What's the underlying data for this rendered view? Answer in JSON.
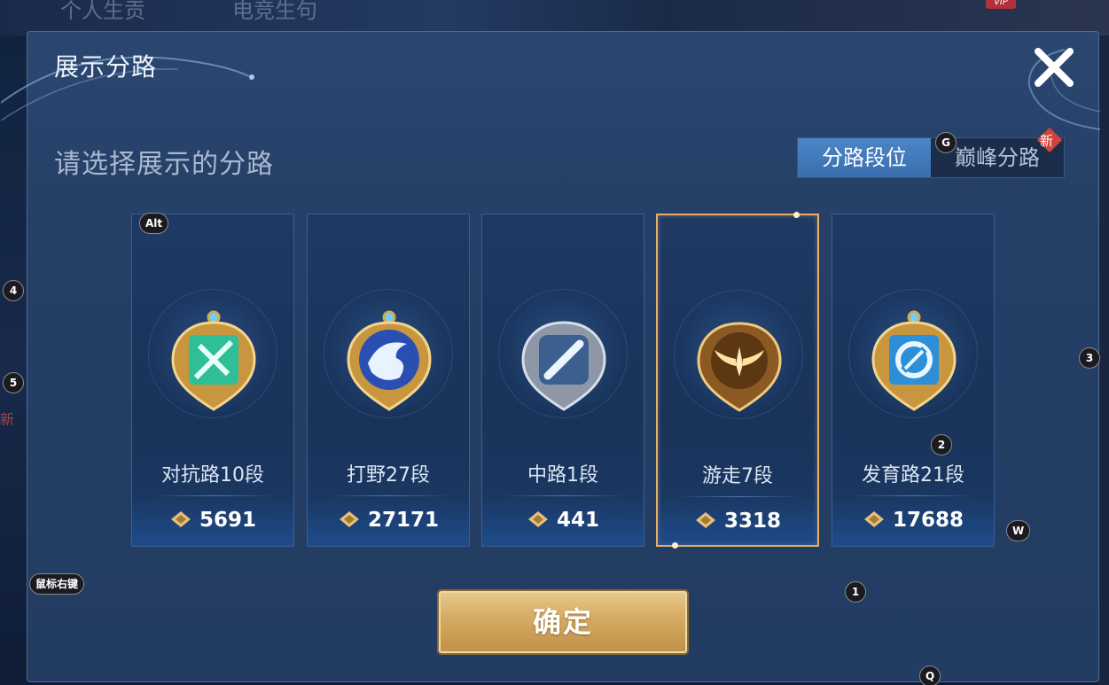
{
  "background": {
    "top_texts": [
      "个人生贡",
      "电竞生句"
    ],
    "vip": "VIP",
    "side_new": "新"
  },
  "dialog": {
    "title": "展示分路",
    "subtitle": "请选择展示的分路",
    "close_icon": "close-x-icon"
  },
  "tabs": [
    {
      "label": "分路段位",
      "active": true
    },
    {
      "label": "巅峰分路",
      "active": false,
      "badge": "新"
    }
  ],
  "roles": [
    {
      "name": "对抗路10段",
      "score": "5691",
      "icon": "sword-crossed-emblem-icon",
      "accent": "#3fc7a3",
      "selected": false
    },
    {
      "name": "打野27段",
      "score": "27171",
      "icon": "dragon-emblem-icon",
      "accent": "#2f62c9",
      "selected": false
    },
    {
      "name": "中路1段",
      "score": "441",
      "icon": "slash-emblem-icon",
      "accent": "#7f8fa6",
      "selected": false
    },
    {
      "name": "游走7段",
      "score": "3318",
      "icon": "wings-emblem-icon",
      "accent": "#b8873e",
      "selected": true
    },
    {
      "name": "发育路21段",
      "score": "17688",
      "icon": "bow-emblem-icon",
      "accent": "#2f9ae0",
      "selected": false
    }
  ],
  "confirm": {
    "label": "确定"
  },
  "hints": {
    "alt": "Alt",
    "g": "G",
    "four": "4",
    "five": "5",
    "three": "3",
    "two": "2",
    "w": "W",
    "right_click": "鼠标右键",
    "one": "1",
    "q": "Q"
  },
  "colors": {
    "gold": "#e6b06a",
    "tab_active": "#3f78bb",
    "dialog_bg": "#253f66"
  }
}
